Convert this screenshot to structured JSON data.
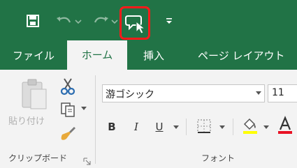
{
  "quick_access": {
    "save_icon": "save-icon",
    "undo_icon": "undo-icon",
    "redo_icon": "redo-icon",
    "highlighted_icon": "speech-bubble-cursor-icon",
    "customize_icon": "customize-dropdown-icon",
    "highlight_color": "#ff1a1a"
  },
  "tabs": [
    {
      "label": "ファイル"
    },
    {
      "label": "ホーム",
      "active": true
    },
    {
      "label": "挿入"
    },
    {
      "label": "ページ レイアウト"
    }
  ],
  "clipboard": {
    "paste_label": "貼り付け",
    "group_label": "クリップボード"
  },
  "font": {
    "font_name": "游ゴシック",
    "font_size": "11",
    "bold": "B",
    "italic": "I",
    "underline": "U",
    "group_label": "フォント",
    "highlight_color": "#ffff00",
    "font_color": "#e81123"
  },
  "theme": {
    "accent": "#217346"
  }
}
